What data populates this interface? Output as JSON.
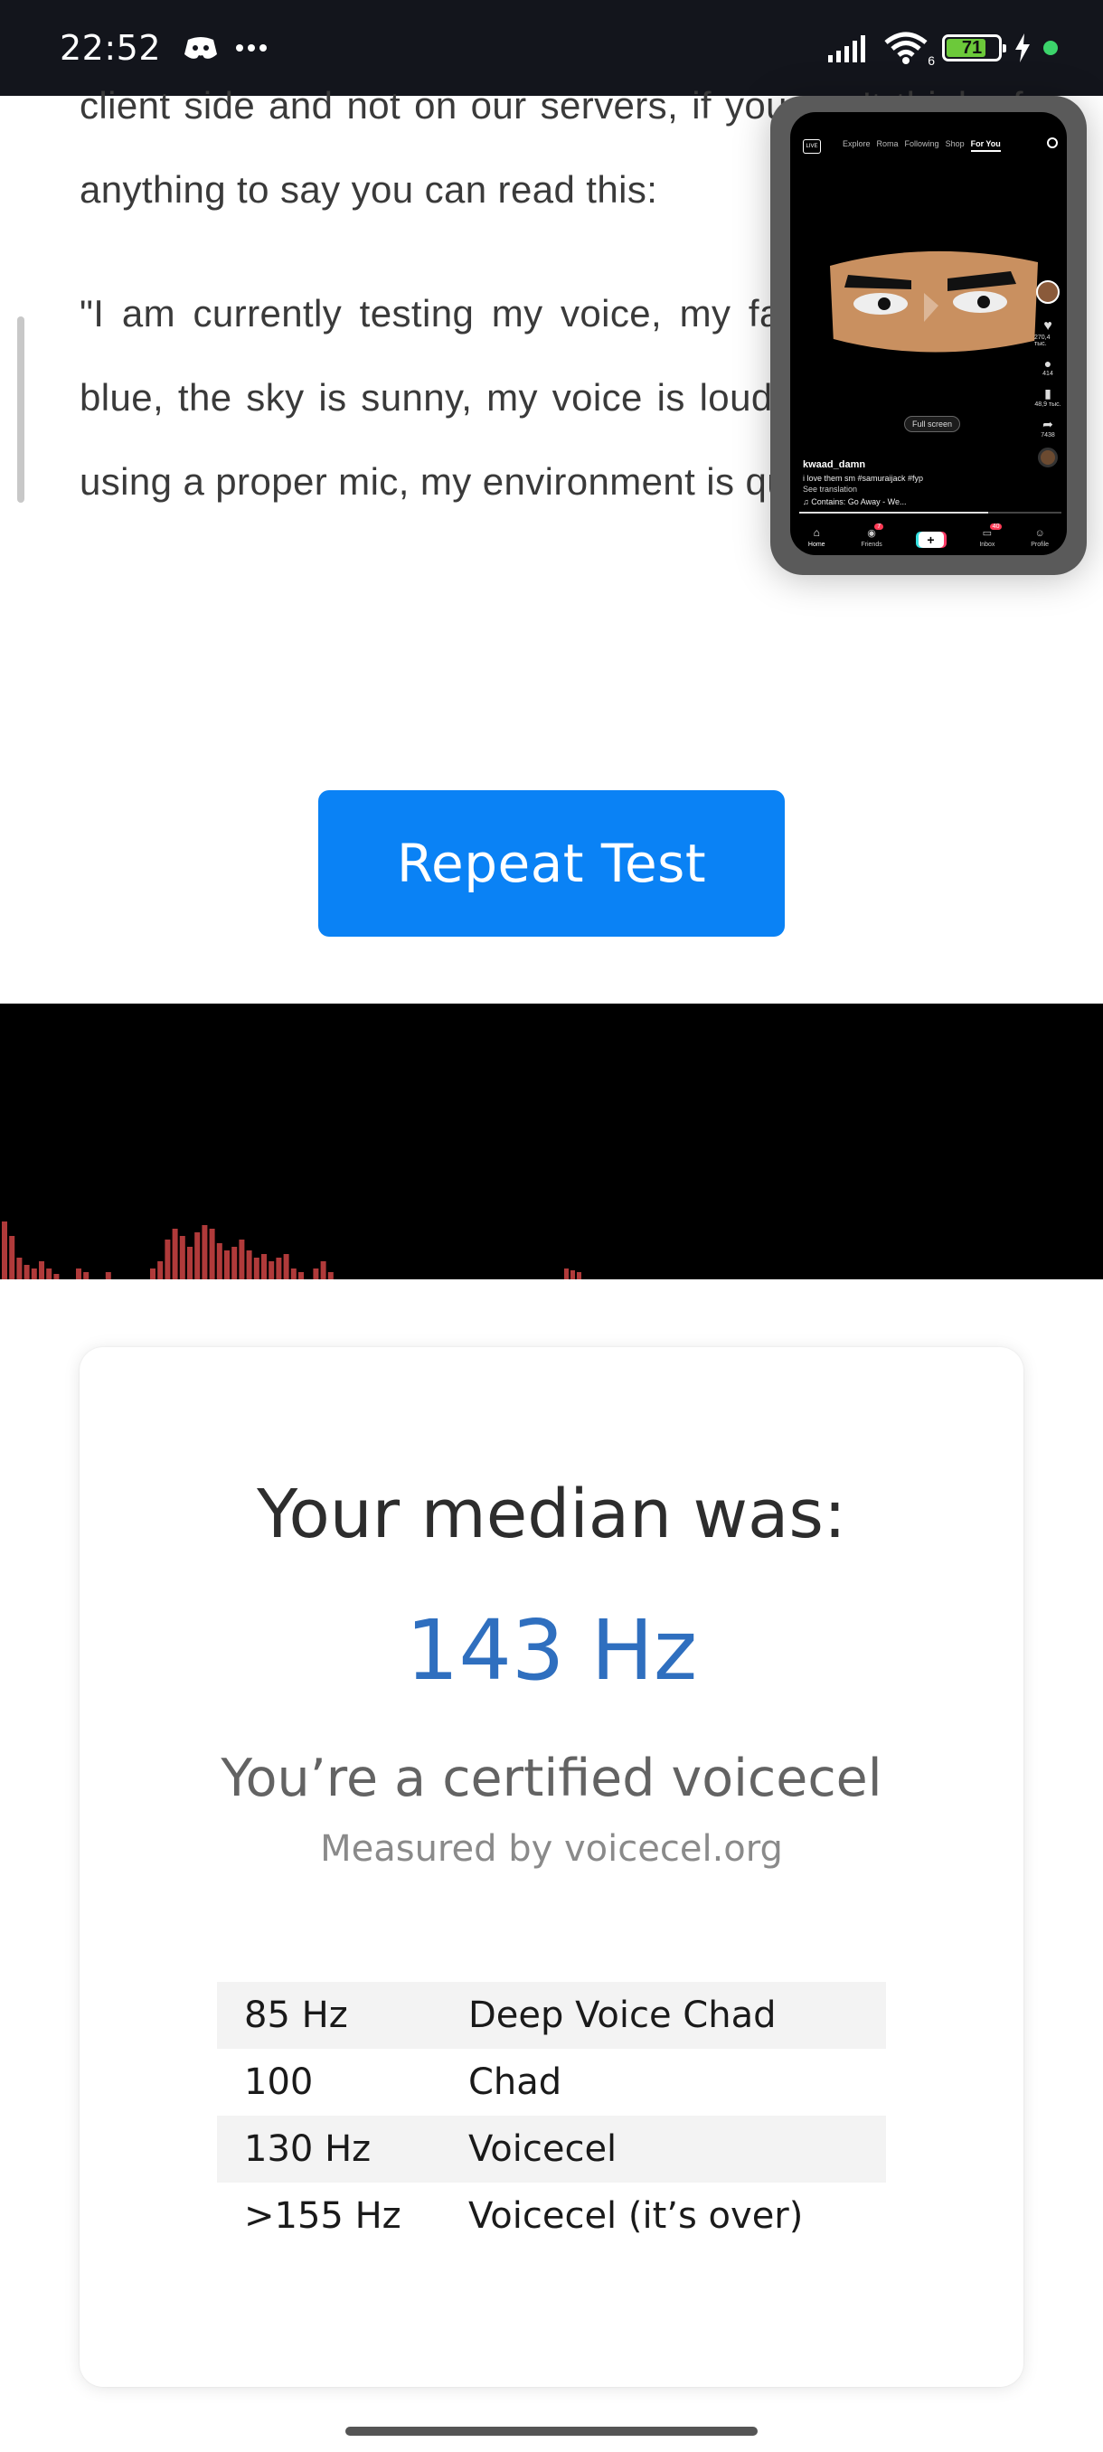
{
  "status_bar": {
    "time": "22:52",
    "battery_level": "71",
    "battery_fraction": 0.71,
    "network_label": "6",
    "icons": [
      "discord-icon",
      "more-icon",
      "signal-icon",
      "wifi-icon",
      "battery-icon",
      "charging-icon",
      "active-dot-icon"
    ]
  },
  "article": {
    "paragraph_1": "client side and not on our servers, if you can't think of anything to say you can read this:",
    "paragraph_2": "\"I am currently testing my voice, my favorite color is blue, the sky is sunny, my voice is loud and clear, I'm using a proper mic, my environment is quiet.\""
  },
  "repeat_button": {
    "label": "Repeat Test"
  },
  "visualizer": {
    "bar_color": "#b03a3a",
    "levels": [
      0.32,
      0.24,
      0.12,
      0.08,
      0.06,
      0.1,
      0.06,
      0.03,
      0.0,
      0.0,
      0.06,
      0.04,
      0.0,
      0.0,
      0.04,
      0.0,
      0.0,
      0.0,
      0.0,
      0.0,
      0.06,
      0.1,
      0.22,
      0.28,
      0.24,
      0.18,
      0.26,
      0.3,
      0.28,
      0.2,
      0.16,
      0.18,
      0.22,
      0.16,
      0.12,
      0.14,
      0.1,
      0.12,
      0.14,
      0.06,
      0.04,
      0.0,
      0.06,
      0.1,
      0.04
    ]
  },
  "result": {
    "title": "Your median was:",
    "value": "143 Hz",
    "verdict": "You’re a certified voicecel",
    "measured_by": "Measured by voicecel.org",
    "value_color": "#2f6fbf",
    "scale": [
      {
        "freq": "85 Hz",
        "label": "Deep Voice Chad"
      },
      {
        "freq": "100",
        "label": "Chad"
      },
      {
        "freq": "130 Hz",
        "label": "Voicecel"
      },
      {
        "freq": ">155 Hz",
        "label": "Voicecel (it’s over)"
      }
    ]
  },
  "pip": {
    "live_label": "LIVE",
    "tabs": [
      "Explore",
      "Roma",
      "Following",
      "Shop",
      "For You"
    ],
    "fullscreen_label": "Full screen",
    "likes": "270,4 тыс.",
    "comments": "414",
    "saves": "48,9 тыс.",
    "shares": "7438",
    "username": "kwaad_damn",
    "caption": "i love them sm #samuraijack #fyp",
    "see_translation": "See translation",
    "sound": "♫ Contains: Go Away - We...",
    "nav": [
      "Home",
      "Friends",
      "+",
      "Inbox",
      "Profile"
    ],
    "friends_badge": "7",
    "inbox_badge": "40",
    "progress": 0.72
  }
}
